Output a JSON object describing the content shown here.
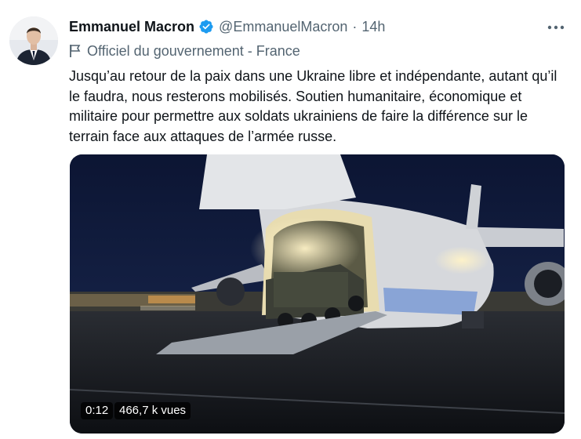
{
  "author": {
    "name": "Emmanuel Macron",
    "handle": "@EmmanuelMacron",
    "separator": "·",
    "time": "14h"
  },
  "label": "Officiel du gouvernement - France",
  "text": "Jusqu’au retour de la paix dans une Ukraine libre et indépendante, autant qu’il le faudra, nous resterons mobilisés. Soutien humanitaire, économique et militaire pour permettre aux soldats ukrainiens de faire la différence sur le terrain face aux attaques de l’armée russe.",
  "video": {
    "duration": "0:12",
    "views": "466,7 k vues"
  },
  "colors": {
    "verified": "#1d9bf0",
    "secondary_text": "#536471",
    "primary_text": "#0f1419"
  },
  "icons": {
    "verified": "verified-badge-icon",
    "more": "more-dots-icon",
    "label": "flag-icon"
  }
}
